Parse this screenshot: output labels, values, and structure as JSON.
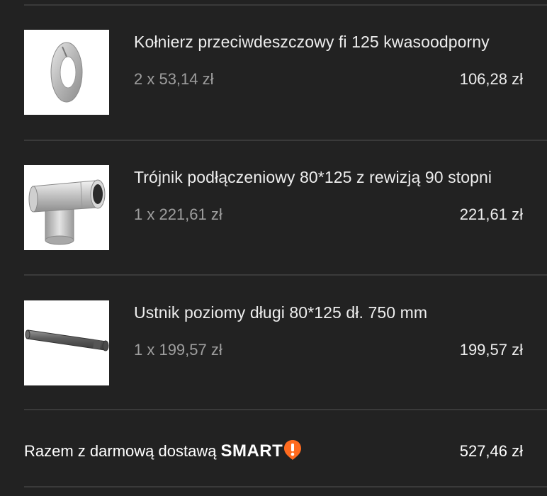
{
  "cart": {
    "items": [
      {
        "name": "Kołnierz przeciwdeszczowy fi 125 kwasoodporny",
        "quantity_price": "2 x 53,14 zł",
        "total": "106,28 zł",
        "image_icon": "flange-collar-image"
      },
      {
        "name": "Trójnik podłączeniowy 80*125 z rewizją 90 stopni",
        "quantity_price": "1 x 221,61 zł",
        "total": "221,61 zł",
        "image_icon": "tee-pipe-image"
      },
      {
        "name": "Ustnik poziomy długi 80*125 dł. 750 mm",
        "quantity_price": "1 x 199,57 zł",
        "total": "199,57 zł",
        "image_icon": "horizontal-terminal-pipe-image"
      }
    ],
    "summary": {
      "label": "Razem z darmową dostawą",
      "badge_text": "SMART",
      "badge_icon": "smart-exclamation-icon",
      "total": "527,46 zł"
    }
  },
  "colors": {
    "background": "#222222",
    "divider": "#3a3a3a",
    "primary_text": "#ededed",
    "secondary_text": "#9e9e9e",
    "smart_accent": "#ff6b1f"
  }
}
